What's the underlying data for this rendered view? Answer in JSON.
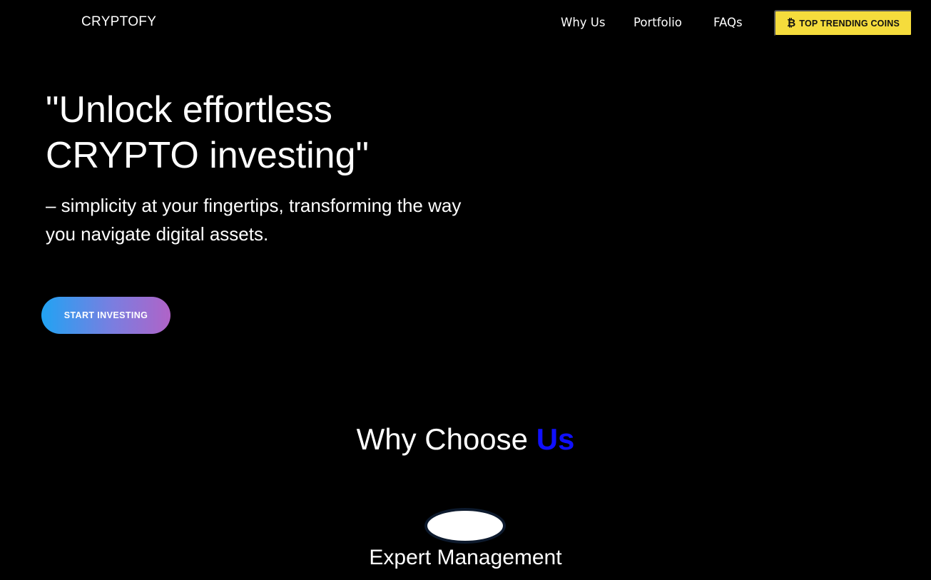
{
  "navbar": {
    "brand": "CRYPTOFY",
    "links": [
      "Why Us",
      "Portfolio",
      "FAQs"
    ],
    "cta_icon": "bitcoin-icon",
    "cta_symbol": "₿",
    "cta_label": "TOP TRENDING COINS"
  },
  "hero": {
    "title_line1": "\"Unlock effortless",
    "title_line2": "CRYPTO investing\"",
    "subtitle": "– simplicity at your fingertips, transforming the way you navigate digital assets.",
    "button_label": "START INVESTING"
  },
  "why": {
    "title_prefix": "Why Choose ",
    "title_accent": "Us",
    "feature_title": "Expert Management"
  },
  "colors": {
    "background": "#000000",
    "accent_blue": "#1010ff",
    "cta_yellow": "#f5dc3c",
    "gradient_start": "#21a3f3",
    "gradient_end": "#b063c7"
  }
}
